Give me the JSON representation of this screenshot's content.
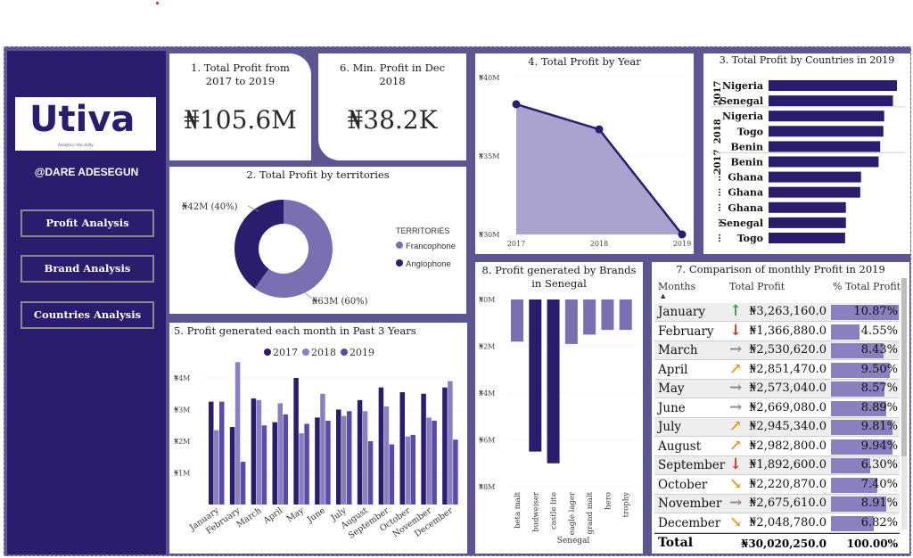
{
  "sidebar": {
    "logo_text": "Utiva",
    "logo_tagline": "Analytics into utility",
    "handle": "@DARE ADESEGUN",
    "nav": [
      {
        "label": "Profit Analysis"
      },
      {
        "label": "Brand Analysis"
      },
      {
        "label": "Countries Analysis"
      }
    ]
  },
  "kpi1": {
    "title": "1. Total Profit from 2017 to 2019",
    "value": "₦105.6M"
  },
  "kpi6": {
    "title": "6. Min. Profit in Dec 2018",
    "value": "₦38.2K"
  },
  "territories": {
    "title": "2. Total Profit by territories",
    "legend_title": "TERRITORIES",
    "labels": {
      "anglophone": "₦42M (40%)",
      "francophone": "₦63M (60%)"
    },
    "colors": {
      "Francophone": "#7a6fb0",
      "Anglophone": "#2b1c6e"
    }
  },
  "year_chart_title": "4. Total Profit by Year",
  "countries_chart_title": "3. Total Profit by Countries in 2019",
  "monthly_chart": {
    "title": "5. Profit generated each month in Past 3 Years",
    "colors": {
      "2017": "#2b1c6e",
      "2018": "#8a80c0",
      "2019": "#5b4aa8"
    }
  },
  "brands_chart": {
    "title": "8. Profit generated by Brands in Senegal"
  },
  "comparison": {
    "title": "7. Comparison of monthly Profit in 2019",
    "headers": [
      "Months",
      "Total Profit",
      "% Total Profit"
    ],
    "rows": [
      {
        "month": "January",
        "arrow": "↑",
        "arrow_color": "#2e9e3e",
        "profit": "₦3,263,160.0",
        "pct": "10.87%",
        "pct_value": 10.87
      },
      {
        "month": "February",
        "arrow": "↓",
        "arrow_color": "#d0312d",
        "profit": "₦1,366,880.0",
        "pct": "4.55%",
        "pct_value": 4.55
      },
      {
        "month": "March",
        "arrow": "→",
        "arrow_color": "#8a8a8a",
        "profit": "₦2,530,620.0",
        "pct": "8.43%",
        "pct_value": 8.43
      },
      {
        "month": "April",
        "arrow": "↗",
        "arrow_color": "#e09b20",
        "profit": "₦2,851,470.0",
        "pct": "9.50%",
        "pct_value": 9.5
      },
      {
        "month": "May",
        "arrow": "→",
        "arrow_color": "#8a8a8a",
        "profit": "₦2,573,040.0",
        "pct": "8.57%",
        "pct_value": 8.57
      },
      {
        "month": "June",
        "arrow": "→",
        "arrow_color": "#8a8a8a",
        "profit": "₦2,669,080.0",
        "pct": "8.89%",
        "pct_value": 8.89
      },
      {
        "month": "July",
        "arrow": "↗",
        "arrow_color": "#e09b20",
        "profit": "₦2,945,340.0",
        "pct": "9.81%",
        "pct_value": 9.81
      },
      {
        "month": "August",
        "arrow": "↗",
        "arrow_color": "#e09b20",
        "profit": "₦2,982,800.0",
        "pct": "9.94%",
        "pct_value": 9.94
      },
      {
        "month": "September",
        "arrow": "↓",
        "arrow_color": "#d0312d",
        "profit": "₦1,892,600.0",
        "pct": "6.30%",
        "pct_value": 6.3
      },
      {
        "month": "October",
        "arrow": "↘",
        "arrow_color": "#e09b20",
        "profit": "₦2,220,870.0",
        "pct": "7.40%",
        "pct_value": 7.4
      },
      {
        "month": "November",
        "arrow": "→",
        "arrow_color": "#8a8a8a",
        "profit": "₦2,675,610.0",
        "pct": "8.91%",
        "pct_value": 8.91
      },
      {
        "month": "December",
        "arrow": "↘",
        "arrow_color": "#e09b20",
        "profit": "₦2,048,780.0",
        "pct": "6.82%",
        "pct_value": 6.82
      }
    ],
    "total": {
      "label": "Total",
      "profit": "₦30,020,250.0",
      "pct": "100.00%"
    }
  },
  "chart_data": [
    {
      "type": "pie",
      "title": "2. Total Profit by territories",
      "categories": [
        "Francophone",
        "Anglophone"
      ],
      "values": [
        63,
        42
      ],
      "unit": "₦M",
      "legend": "right"
    },
    {
      "type": "area",
      "title": "4. Total Profit by Year",
      "x": [
        "2017",
        "2018",
        "2019"
      ],
      "values": [
        38.3,
        36.7,
        30.0
      ],
      "ylim": [
        30,
        40
      ],
      "yticks": [
        "₦30M",
        "₦35M",
        "₦40M"
      ]
    },
    {
      "type": "bar",
      "title": "3. Total Profit by Countries in 2019",
      "orientation": "horizontal",
      "categories": [
        "Nigeria",
        "Senegal",
        "Nigeria",
        "Togo",
        "Benin",
        "Benin",
        "Ghana",
        "Ghana",
        "Ghana",
        "Senegal",
        "Togo"
      ],
      "year_groups": [
        "2017",
        "2017",
        "2018",
        "2018",
        "2018",
        "2017",
        "…",
        "…",
        "…",
        "…",
        "…"
      ],
      "values": [
        8.05,
        7.8,
        7.25,
        7.2,
        7.0,
        6.9,
        5.8,
        5.75,
        4.85,
        4.85,
        4.8
      ],
      "unit": "₦M"
    },
    {
      "type": "bar",
      "title": "5. Profit generated each month in Past 3 Years",
      "categories": [
        "January",
        "February",
        "March",
        "April",
        "May",
        "June",
        "July",
        "August",
        "September",
        "October",
        "November",
        "December"
      ],
      "series": [
        {
          "name": "2017",
          "values": [
            3.25,
            2.45,
            3.35,
            2.6,
            4.0,
            2.75,
            3.0,
            3.3,
            3.7,
            3.55,
            3.5,
            3.7
          ]
        },
        {
          "name": "2018",
          "values": [
            2.35,
            4.5,
            3.3,
            3.2,
            2.25,
            3.5,
            2.8,
            2.95,
            3.1,
            2.15,
            2.75,
            3.9
          ]
        },
        {
          "name": "2019",
          "values": [
            3.25,
            1.35,
            2.5,
            2.85,
            2.55,
            2.65,
            2.95,
            2.0,
            1.9,
            2.2,
            2.65,
            2.05
          ]
        }
      ],
      "ylim": [
        0,
        5
      ],
      "yticks": [
        "₦1M",
        "₦2M",
        "₦3M",
        "₦4M"
      ],
      "legend": "top"
    },
    {
      "type": "bar",
      "title": "8. Profit generated by Brands in Senegal",
      "categories": [
        "beta malt",
        "budweiser",
        "castle lite",
        "eagle lager",
        "grand malt",
        "hero",
        "trophy"
      ],
      "values": [
        -1.8,
        -6.5,
        -7.0,
        -1.9,
        -1.5,
        -1.3,
        -1.3
      ],
      "ylim": [
        -8,
        0
      ],
      "yticks": [
        "₦0M",
        "₦2M",
        "₦4M",
        "₦6M",
        "₦8M"
      ],
      "xlabel": "Senegal"
    }
  ]
}
